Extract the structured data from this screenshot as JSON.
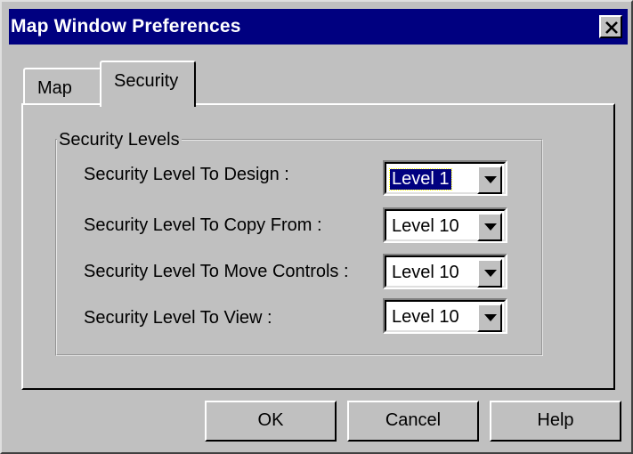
{
  "window": {
    "title": "Map Window Preferences"
  },
  "tabs": [
    {
      "label": "Map",
      "active": false
    },
    {
      "label": "Security",
      "active": true
    }
  ],
  "security": {
    "group_label": "Security Levels",
    "rows": [
      {
        "label": "Security Level To Design :",
        "value": "Level 1",
        "focused": true
      },
      {
        "label": "Security Level To Copy From :",
        "value": "Level 10",
        "focused": false
      },
      {
        "label": "Security Level To Move Controls :",
        "value": "Level 10",
        "focused": false
      },
      {
        "label": "Security Level To View :",
        "value": "Level 10",
        "focused": false
      }
    ]
  },
  "buttons": {
    "ok": "OK",
    "cancel": "Cancel",
    "help": "Help"
  },
  "icons": {
    "close": "close-icon",
    "dropdown": "chevron-down-icon"
  },
  "colors": {
    "titlebar": "#000080",
    "face": "#c0c0c0",
    "selection": "#000080"
  }
}
